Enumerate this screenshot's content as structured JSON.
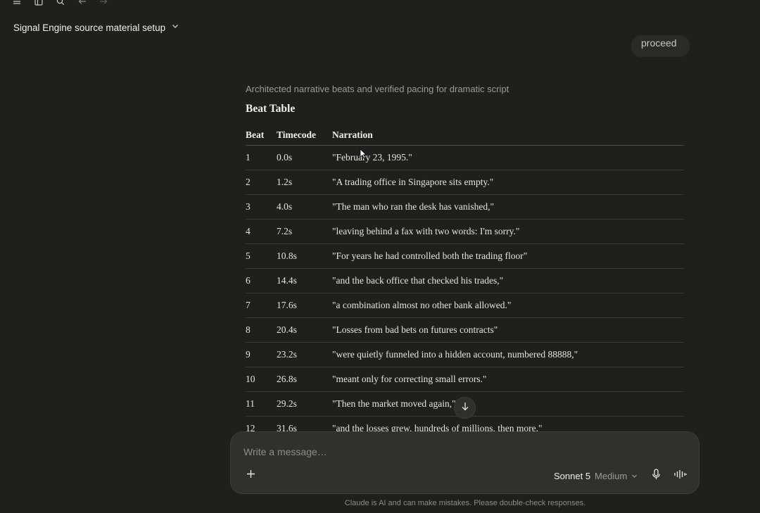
{
  "toolbar": {
    "icons": [
      "menu-icon",
      "sidebar-icon",
      "search-icon",
      "back-arrow-icon",
      "forward-arrow-icon"
    ]
  },
  "conversation": {
    "title": "Signal Engine source material setup"
  },
  "previous_message": {
    "text": "proceed"
  },
  "response": {
    "summary": "Architected narrative beats and verified pacing for dramatic script",
    "section_title": "Beat Table",
    "table": {
      "headers": [
        "Beat",
        "Timecode",
        "Narration"
      ],
      "rows": [
        [
          "1",
          "0.0s",
          "\"February 23, 1995.\""
        ],
        [
          "2",
          "1.2s",
          "\"A trading office in Singapore sits empty.\""
        ],
        [
          "3",
          "4.0s",
          "\"The man who ran the desk has vanished,\""
        ],
        [
          "4",
          "7.2s",
          "\"leaving behind a fax with two words: I'm sorry.\""
        ],
        [
          "5",
          "10.8s",
          "\"For years he had controlled both the trading floor\""
        ],
        [
          "6",
          "14.4s",
          "\"and the back office that checked his trades,\""
        ],
        [
          "7",
          "17.6s",
          "\"a combination almost no other bank allowed.\""
        ],
        [
          "8",
          "20.4s",
          "\"Losses from bad bets on futures contracts\""
        ],
        [
          "9",
          "23.2s",
          "\"were quietly funneled into a hidden account, numbered 88888,\""
        ],
        [
          "10",
          "26.8s",
          "\"meant only for correcting small errors.\""
        ],
        [
          "11",
          "29.2s",
          "\"Then the market moved again,\""
        ],
        [
          "12",
          "31.6s",
          "\"and the losses grew, hundreds of millions, then more.\""
        ]
      ]
    }
  },
  "composer": {
    "placeholder": "Write a message…",
    "model": "Sonnet 5",
    "effort": "Medium"
  },
  "footer": {
    "disclaimer": "Claude is AI and can make mistakes. Please double-check responses."
  },
  "colors": {
    "background": "#1f1f1e",
    "composer": "#30302e",
    "text": "#e8e6e1",
    "muted": "#9d9b95"
  }
}
